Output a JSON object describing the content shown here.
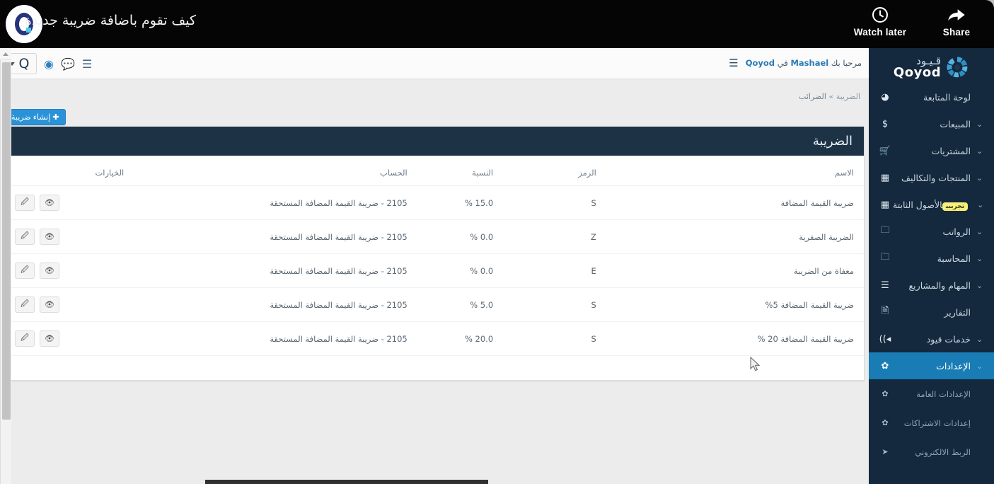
{
  "video_overlay": {
    "title": "كيف تقوم باضافة ضريبة جديدة",
    "logo_icon": "qoyod-circle-logo",
    "actions": [
      {
        "label": "Watch later",
        "icon": "clock-icon"
      },
      {
        "label": "Share",
        "icon": "share-arrow-icon"
      }
    ]
  },
  "sidebar": {
    "brand": {
      "arabic": "قـيـود",
      "english": "Qoyod",
      "icon": "qoyod-burst-icon"
    },
    "items": [
      {
        "label": "لوحة المتابعة",
        "icon": "dashboard-icon",
        "caret": "",
        "active": false,
        "badge": ""
      },
      {
        "label": "المبيعات",
        "icon": "dollar-icon",
        "caret": "⌄",
        "active": false,
        "badge": ""
      },
      {
        "label": "المشتريات",
        "icon": "cart-icon",
        "caret": "⌄",
        "active": false,
        "badge": ""
      },
      {
        "label": "المنتجات والتكاليف",
        "icon": "grid-icon",
        "caret": "⌄",
        "active": false,
        "badge": ""
      },
      {
        "label": "الأصول الثابتة",
        "icon": "grid-icon",
        "caret": "⌄",
        "active": false,
        "badge": "تجريبي"
      },
      {
        "label": "الرواتب",
        "icon": "folder-icon",
        "caret": "⌄",
        "active": false,
        "badge": ""
      },
      {
        "label": "المحاسبة",
        "icon": "folder-icon",
        "caret": "⌄",
        "active": false,
        "badge": ""
      },
      {
        "label": "المهام والمشاريع",
        "icon": "list-icon",
        "caret": "⌄",
        "active": false,
        "badge": ""
      },
      {
        "label": "التقارير",
        "icon": "file-icon",
        "caret": "",
        "active": false,
        "badge": ""
      },
      {
        "label": "خدمات قيود",
        "icon": "megaphone-icon",
        "caret": "⌄",
        "active": false,
        "badge": ""
      },
      {
        "label": "الإعدادات",
        "icon": "gear-icon",
        "caret": "⌄",
        "active": true,
        "badge": ""
      }
    ],
    "subitems": [
      {
        "label": "الإعدادات العامة",
        "icon": "gear-icon"
      },
      {
        "label": "إعدادات الاشتراكات",
        "icon": "gear-icon"
      },
      {
        "label": "الربط الالكتروني",
        "icon": "paper-plane-icon"
      }
    ]
  },
  "header": {
    "greeting_prefix": "مرحبا بك",
    "user": "Mashael",
    "greeting_mid": "في",
    "company": "Qoyod",
    "menu_icon": "hamburger-icon",
    "toolbar_icons": [
      "qoyod-q-icon",
      "lifebuoy-icon",
      "chat-icon",
      "list-icon"
    ]
  },
  "breadcrumb": {
    "current": "الضريبة",
    "separator": "»",
    "parent": "الضرائب"
  },
  "actions": {
    "create_label": "إنشاء ضريبة",
    "create_icon": "plus-icon"
  },
  "panel": {
    "title": "الضريبة",
    "columns": [
      "الاسم",
      "الرمز",
      "النسبة",
      "الحساب",
      "الخيارات"
    ],
    "rows": [
      {
        "name": "ضريبة القيمة المضافة",
        "code": "S",
        "rate": "15.0 %",
        "account": "2105 - ضريبة القيمة المضافة المستحقة"
      },
      {
        "name": "الضريبة الصفرية",
        "code": "Z",
        "rate": "0.0 %",
        "account": "2105 - ضريبة القيمة المضافة المستحقة"
      },
      {
        "name": "معفاة من الضريبة",
        "code": "E",
        "rate": "0.0 %",
        "account": "2105 - ضريبة القيمة المضافة المستحقة"
      },
      {
        "name": "ضريبة القيمة المضافة 5%",
        "code": "S",
        "rate": "5.0 %",
        "account": "2105 - ضريبة القيمة المضافة المستحقة"
      },
      {
        "name": "ضريبة القيمة المضافة 20 %",
        "code": "S",
        "rate": "20.0 %",
        "account": "2105 - ضريبة القيمة المضافة المستحقة"
      }
    ],
    "row_actions": [
      {
        "name": "edit-button",
        "icon": "pencil-square-icon"
      },
      {
        "name": "view-button",
        "icon": "eye-icon"
      }
    ]
  },
  "colors": {
    "sidebar_bg": "#14293d",
    "sidebar_active": "#1a7cb5",
    "panel_head_bg": "#1e3246",
    "accent_blue": "#2a93d8",
    "badge_yellow": "#f7f07a",
    "overlay_black": "#050505"
  }
}
